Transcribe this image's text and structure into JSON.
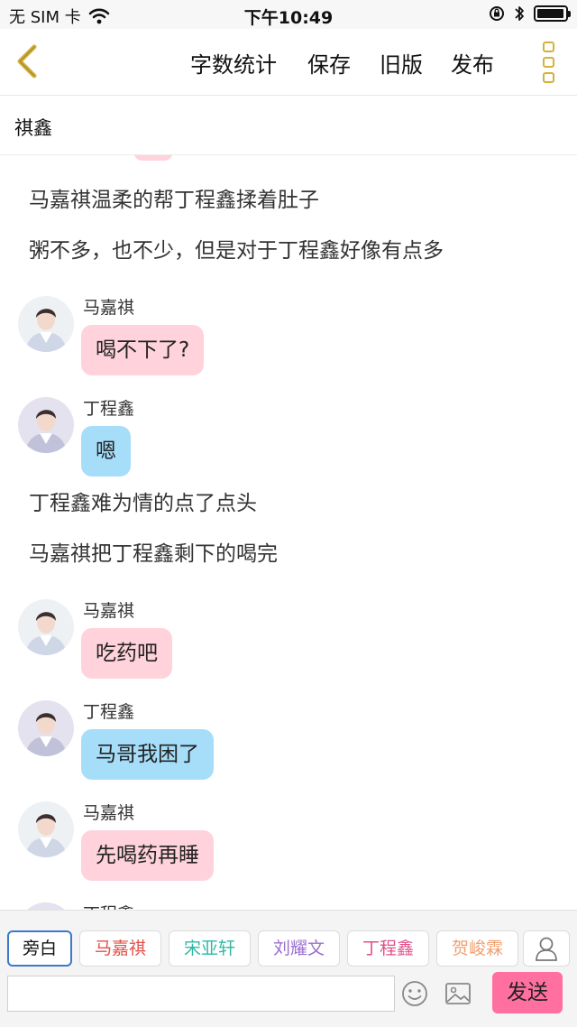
{
  "status_bar": {
    "carrier": "无 SIM 卡",
    "time": "下午10:49",
    "battery_level": 0.95
  },
  "navbar": {
    "word_count": "字数统计",
    "save": "保存",
    "old_version": "旧版",
    "publish": "发布",
    "accent_color": "#d4b23a"
  },
  "chat_title": "祺鑫",
  "messages": [
    {
      "type": "narration",
      "text": "马嘉祺温柔的帮丁程鑫揉着肚子"
    },
    {
      "type": "narration",
      "text": "粥不多，也不少，但是对于丁程鑫好像有点多"
    },
    {
      "type": "message",
      "sender": "马嘉祺",
      "text": "喝不下了?",
      "color": "pink"
    },
    {
      "type": "message",
      "sender": "丁程鑫",
      "text": "嗯",
      "color": "blue"
    },
    {
      "type": "narration",
      "text": "丁程鑫难为情的点了点头"
    },
    {
      "type": "narration",
      "text": "马嘉祺把丁程鑫剩下的喝完"
    },
    {
      "type": "message",
      "sender": "马嘉祺",
      "text": "吃药吧",
      "color": "pink"
    },
    {
      "type": "message",
      "sender": "丁程鑫",
      "text": "马哥我困了",
      "color": "blue"
    },
    {
      "type": "message",
      "sender": "马嘉祺",
      "text": "先喝药再睡",
      "color": "pink"
    },
    {
      "type": "message",
      "sender": "丁程鑫",
      "text": "",
      "color": "blue"
    }
  ],
  "roles": [
    {
      "label": "旁白",
      "color": "#111111",
      "active": true
    },
    {
      "label": "马嘉祺",
      "color": "#e0504a",
      "active": false
    },
    {
      "label": "宋亚轩",
      "color": "#2fb8a6",
      "active": false
    },
    {
      "label": "刘耀文",
      "color": "#9b6fd0",
      "active": false
    },
    {
      "label": "丁程鑫",
      "color": "#e0508a",
      "active": false
    },
    {
      "label": "贺峻霖",
      "color": "#f0a070",
      "active": false
    }
  ],
  "input": {
    "value": "",
    "placeholder": ""
  },
  "send_label": "发送",
  "colors": {
    "pink_bubble": "#ffd2dc",
    "blue_bubble": "#a6defa",
    "send_button": "#ff6fa0"
  }
}
